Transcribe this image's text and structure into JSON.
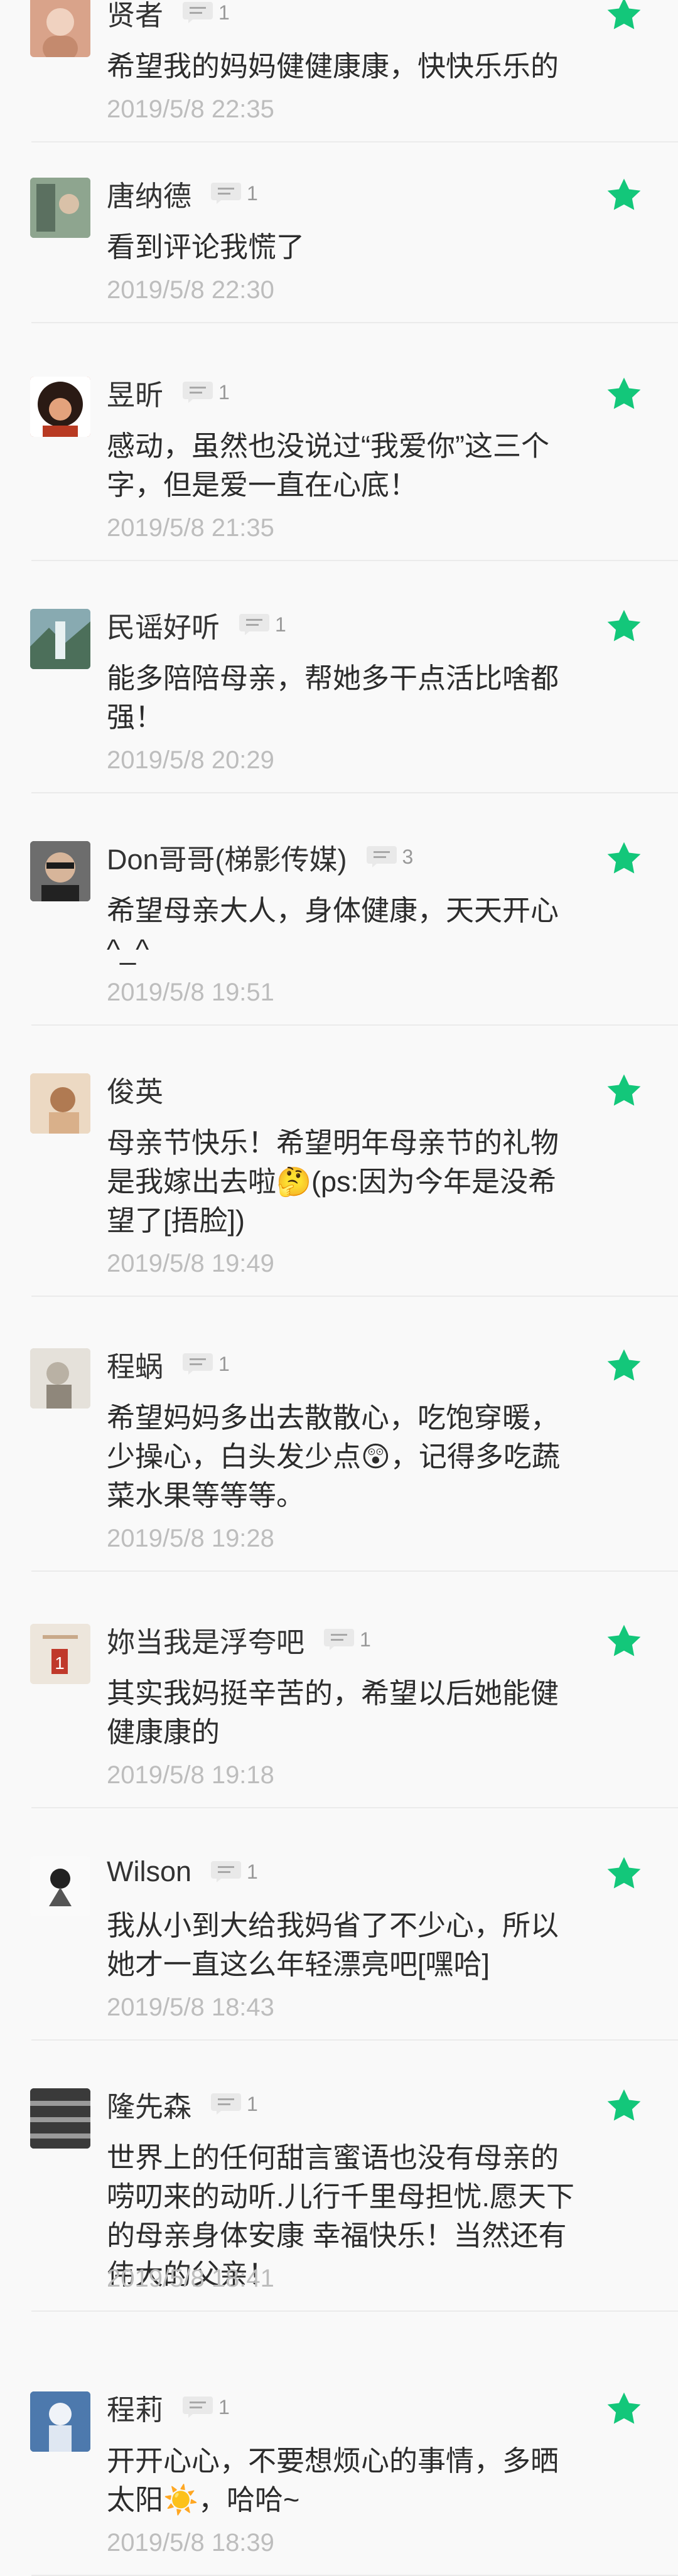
{
  "colors": {
    "accent_green": "#13c77a",
    "date_gray": "#bdbdbd",
    "name_gray": "#333333"
  },
  "comments": [
    {
      "name": "贤者",
      "replies": "1",
      "text": "希望我的妈妈健健康康，快快乐乐的",
      "date": "2019/5/8 22:35",
      "avatar_icon": "avatar-photo-icon"
    },
    {
      "name": "唐纳德",
      "replies": "1",
      "text": "看到评论我慌了",
      "date": "2019/5/8 22:30",
      "avatar_icon": "avatar-photo-icon"
    },
    {
      "name": "昱昕",
      "replies": "1",
      "text": "感动，虽然也没说过“我爱你”这三个字，但是爱一直在心底！",
      "date": "2019/5/8 21:35",
      "avatar_icon": "avatar-photo-icon"
    },
    {
      "name": "民谣好听",
      "replies": "1",
      "text": "能多陪陪母亲，帮她多干点活比啥都强！",
      "date": "2019/5/8 20:29",
      "avatar_icon": "avatar-photo-icon"
    },
    {
      "name": "Don哥哥(梯影传媒)",
      "replies": "3",
      "text": "希望母亲大人，身体健康，天天开心^_^",
      "date": "2019/5/8 19:51",
      "avatar_icon": "avatar-photo-icon"
    },
    {
      "name": "俊英",
      "replies": "",
      "text": "母亲节快乐！希望明年母亲节的礼物是我嫁出去啦🤔(ps:因为今年是没希望了[捂脸])",
      "date": "2019/5/8 19:49",
      "avatar_icon": "avatar-photo-icon"
    },
    {
      "name": "程蜗",
      "replies": "1",
      "text": "希望妈妈多出去散散心，吃饱穿暖，少操心，白头发少点😲，记得多吃蔬菜水果等等等。",
      "date": "2019/5/8 19:28",
      "avatar_icon": "avatar-photo-icon"
    },
    {
      "name": "妳当我是浮夸吧",
      "replies": "1",
      "text": "其实我妈挺辛苦的，希望以后她能健健康康的",
      "date": "2019/5/8 19:18",
      "avatar_icon": "avatar-photo-icon"
    },
    {
      "name": "Wilson",
      "replies": "1",
      "text": "我从小到大给我妈省了不少心，所以她才一直这么年轻漂亮吧[嘿哈]",
      "date": "2019/5/8 18:43",
      "avatar_icon": "avatar-photo-icon"
    },
    {
      "name": "隆先森",
      "replies": "1",
      "text": "世界上的任何甜言蜜语也没有母亲的唠叨来的动听.儿行千里母担忧.愿天下的母亲身体安康 幸福快乐！当然还有伟大的父亲！",
      "date": "2019/5/8 18:41",
      "avatar_icon": "avatar-photo-icon"
    },
    {
      "name": "程莉",
      "replies": "1",
      "text": "开开心心，不要想烦心的事情，多晒太阳☀️，哈哈~",
      "date": "2019/5/8 18:39",
      "avatar_icon": "avatar-photo-icon"
    }
  ]
}
